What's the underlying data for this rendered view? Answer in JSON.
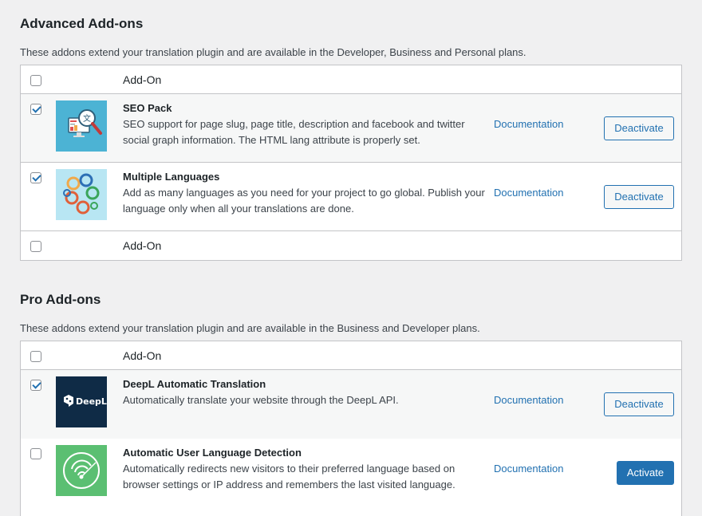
{
  "advanced": {
    "title": "Advanced Add-ons",
    "description": "These addons extend your translation plugin and are available in the Developer, Business and Personal plans.",
    "column_header": "Add-On",
    "footer_label": "Add-On",
    "addons": [
      {
        "name": "SEO Pack",
        "description": "SEO support for page slug, page title, description and facebook and twitter social graph information. The HTML lang attribute is properly set.",
        "doc_label": "Documentation",
        "button_label": "Deactivate",
        "checked": true,
        "icon": "seo-pack-icon"
      },
      {
        "name": "Multiple Languages",
        "description": "Add as many languages as you need for your project to go global. Publish your language only when all your translations are done.",
        "doc_label": "Documentation",
        "button_label": "Deactivate",
        "checked": true,
        "icon": "multiple-languages-icon"
      }
    ]
  },
  "pro": {
    "title": "Pro Add-ons",
    "description": "These addons extend your translation plugin and are available in the Business and Developer plans.",
    "column_header": "Add-On",
    "addons": [
      {
        "name": "DeepL Automatic Translation",
        "description": "Automatically translate your website through the DeepL API.",
        "doc_label": "Documentation",
        "button_label": "Deactivate",
        "checked": true,
        "icon": "deepl-logo",
        "logo_text": "DeepL"
      },
      {
        "name": "Automatic User Language Detection",
        "description": "Automatically redirects new visitors to their preferred language based on browser settings or IP address and remembers the last visited language.",
        "doc_label": "Documentation",
        "button_label": "Activate",
        "checked": false,
        "icon": "language-detection-icon"
      }
    ]
  },
  "colors": {
    "accent": "#2271b1",
    "seo_bg": "#4cb3d4",
    "languages_bg": "#b8e6f3",
    "deepl_bg": "#0f2b46",
    "detection_bg": "#5bbf72"
  }
}
